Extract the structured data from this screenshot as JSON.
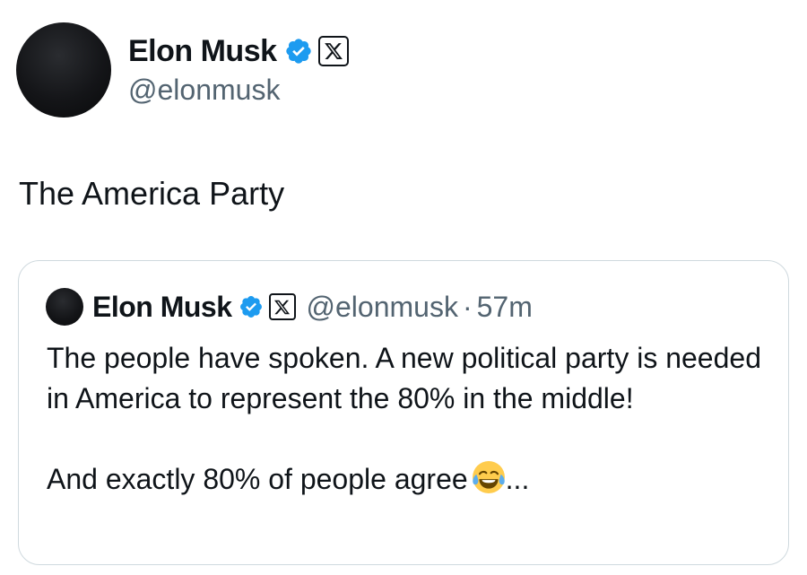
{
  "post": {
    "author": {
      "display_name": "Elon Musk",
      "handle": "@elonmusk",
      "verified_color": "#1d9bf0",
      "affiliation_badge": "x-logo-icon"
    },
    "text": "The America Party"
  },
  "quoted_post": {
    "author": {
      "display_name": "Elon Musk",
      "handle": "@elonmusk"
    },
    "separator": "·",
    "time": "57m",
    "paragraph_1": "The people have spoken. A new political party is needed in America to represent the 80% in the middle!",
    "paragraph_2": "And exactly 80% of people agree",
    "trailing": "...",
    "emoji_name": "face-with-tears-of-joy-icon"
  }
}
